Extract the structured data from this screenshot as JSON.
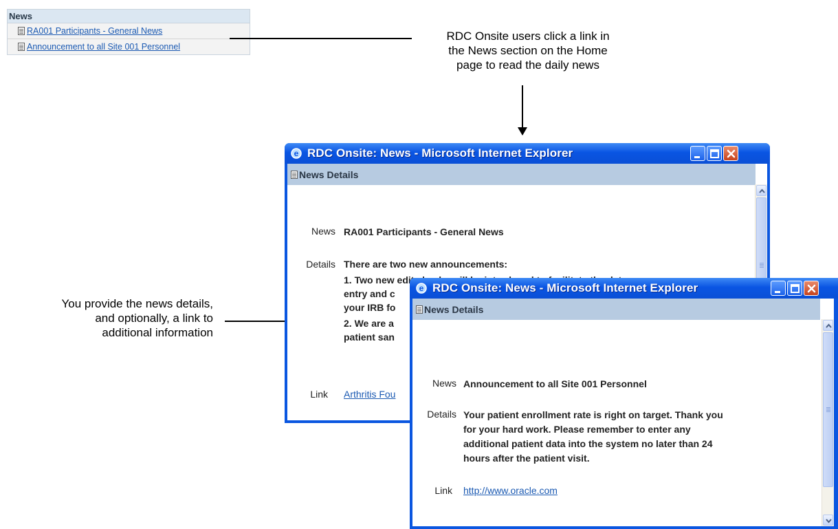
{
  "news_panel": {
    "header": "News",
    "items": [
      {
        "label": "RA001 Participants - General News"
      },
      {
        "label": "Announcement to all Site 001 Personnel"
      }
    ]
  },
  "callouts": {
    "top_right": [
      "RDC Onsite users click a link in",
      "the News section on the Home",
      "page to read the daily news"
    ],
    "left": [
      "You provide the news details,",
      "and optionally, a link to",
      "additional information"
    ]
  },
  "window1": {
    "title": "RDC Onsite: News - Microsoft Internet Explorer",
    "section_header": "News Details",
    "news_label": "News",
    "news_value": "RA001 Participants - General News",
    "details_label": "Details",
    "details_lines": [
      "There are two new announcements:",
      "1. Two new edit checks will be introduced to facilitate the data",
      "entry and c",
      "your IRB fo",
      "2. We are a",
      "patient san"
    ],
    "link_label": "Link",
    "link_value": "Arthritis Fou"
  },
  "window2": {
    "title": "RDC Onsite: News - Microsoft Internet Explorer",
    "section_header": "News Details",
    "news_label": "News",
    "news_value": "Announcement to all Site 001 Personnel",
    "details_label": "Details",
    "details_lines": [
      "Your patient enrollment rate is right on target. Thank you",
      "for your hard work. Please remember to enter any",
      "additional patient data into the system no later than 24",
      "hours after the patient visit."
    ],
    "link_label": "Link",
    "link_value": "http://www.oracle.com"
  },
  "colors": {
    "titlebar": "#0a55e3",
    "header_band": "#b7cbe1",
    "link": "#1a59b2",
    "close_button": "#c7431d"
  },
  "icons": [
    "document-icon",
    "ie-logo-icon",
    "minimize-icon",
    "maximize-icon",
    "close-icon",
    "scroll-up-icon",
    "scroll-down-icon"
  ]
}
